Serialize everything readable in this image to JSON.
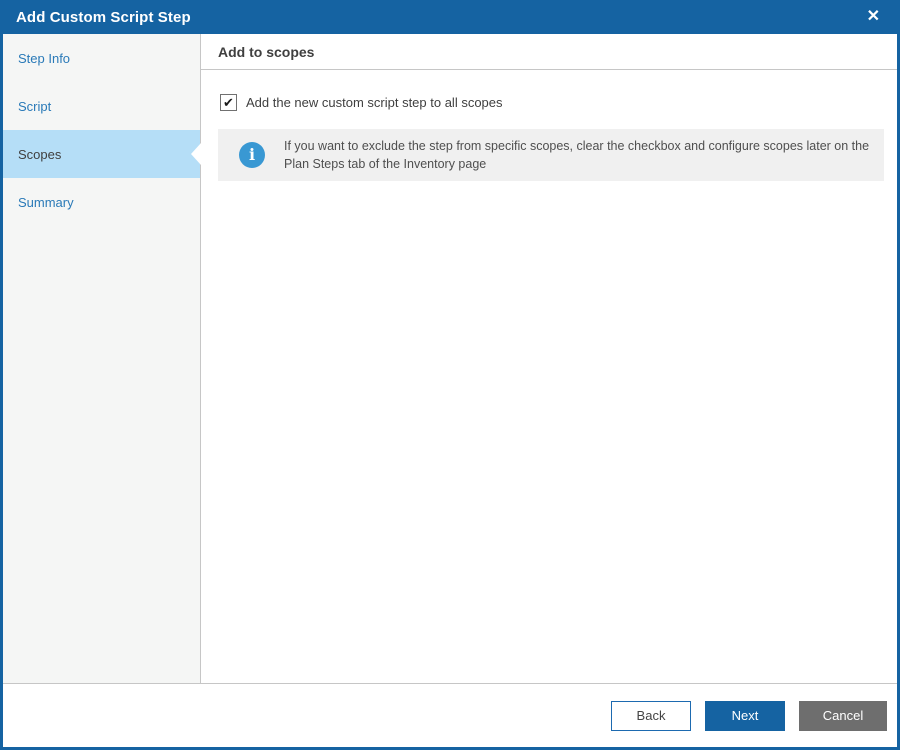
{
  "window": {
    "title": "Add Custom Script Step",
    "close_glyph": "✕",
    "accent_color": "#1563a2",
    "selected_highlight_color": "#b5def7"
  },
  "sidebar": {
    "items": [
      {
        "label": "Step Info",
        "selected": false
      },
      {
        "label": "Script",
        "selected": false
      },
      {
        "label": "Scopes",
        "selected": true
      },
      {
        "label": "Summary",
        "selected": false
      }
    ]
  },
  "main": {
    "heading": "Add to scopes",
    "checkbox": {
      "checked": true,
      "check_glyph": "✔",
      "label": "Add the new custom script step to all scopes"
    },
    "info": {
      "icon_glyph": "i",
      "icon_color": "#3998d3",
      "text": "If you want to exclude the step from specific scopes, clear the checkbox and configure scopes later on the Plan Steps tab of the Inventory page"
    }
  },
  "footer": {
    "buttons": [
      {
        "label": "Back",
        "style": "secondary"
      },
      {
        "label": "Next",
        "style": "primary"
      },
      {
        "label": "Cancel",
        "style": "neutral"
      }
    ]
  }
}
